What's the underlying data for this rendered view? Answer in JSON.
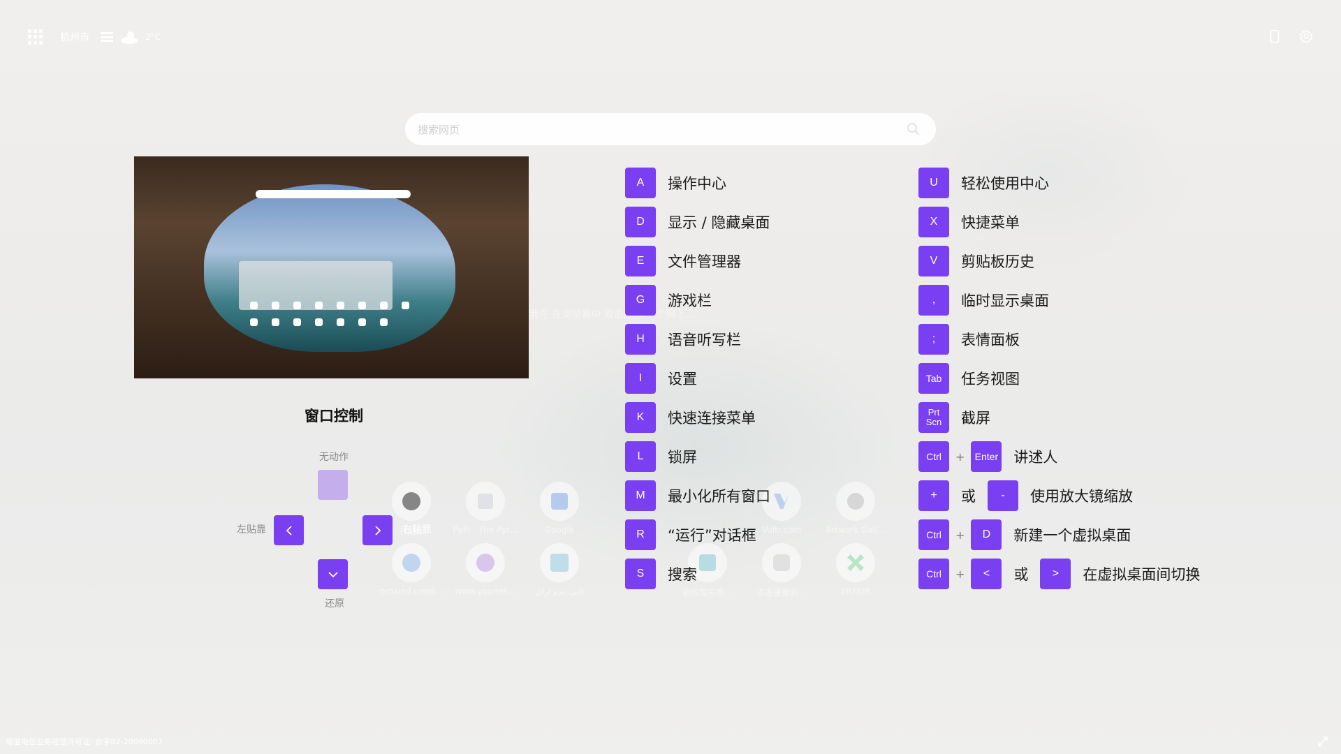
{
  "topbar": {
    "city": "杭州市",
    "temperature": "2°C"
  },
  "search": {
    "placeholder": "搜索网页"
  },
  "ghost_shortcuts": [
    {
      "label": "右贴靠",
      "icon": "github-icon"
    },
    {
      "label": "PyPI · The Pyt...",
      "icon": "pypi-icon"
    },
    {
      "label": "Google",
      "icon": "google-translate-icon"
    },
    {
      "label": "Vultr.com",
      "icon": "vultr-icon"
    },
    {
      "label": "Artwork Gall...",
      "icon": "paw-icon"
    },
    {
      "label": "proxied.unpd...",
      "icon": "u-icon"
    },
    {
      "label": "www.younes...",
      "icon": "v-icon"
    },
    {
      "label": "لایی بیرو ارای",
      "icon": "s-icon"
    },
    {
      "label": "必应每日高...",
      "icon": "bing-icon"
    },
    {
      "label": "点击量最的...",
      "icon": "disk-icon"
    },
    {
      "label": "ERROR",
      "icon": "x-icon"
    }
  ],
  "ghost_text": "我在 在浏览器中 双击图标 一个网上...",
  "window_control": {
    "title": "窗口控制",
    "no_action": "无动作",
    "snap_left": "左贴靠",
    "snap_right": "右贴靠",
    "restore": "还原",
    "up_glyph": "^",
    "left_glyph": "<",
    "right_glyph": ">",
    "down_glyph": "v"
  },
  "shortcuts_left": [
    {
      "key": "A",
      "desc": "操作中心"
    },
    {
      "key": "D",
      "desc": "显示 / 隐藏桌面"
    },
    {
      "key": "E",
      "desc": "文件管理器"
    },
    {
      "key": "G",
      "desc": "游戏栏"
    },
    {
      "key": "H",
      "desc": "语音听写栏"
    },
    {
      "key": "I",
      "desc": "设置"
    },
    {
      "key": "K",
      "desc": "快速连接菜单"
    },
    {
      "key": "L",
      "desc": "锁屏"
    },
    {
      "key": "M",
      "desc": "最小化所有窗口"
    },
    {
      "key": "R",
      "desc": "“运行”对话框"
    },
    {
      "key": "S",
      "desc": "搜索"
    }
  ],
  "shortcuts_right": [
    {
      "key": "U",
      "desc": "轻松使用中心"
    },
    {
      "key": "X",
      "desc": "快捷菜单"
    },
    {
      "key": "V",
      "desc": "剪贴板历史"
    },
    {
      "key": ",",
      "desc": "临时显示桌面"
    },
    {
      "key": ";",
      "desc": "表情面板"
    },
    {
      "key": "Tab",
      "desc": "任务视图"
    },
    {
      "key": "Prt Scn",
      "desc": "截屏"
    }
  ],
  "combos": {
    "narrator": {
      "k1": "Ctrl",
      "plus": "+",
      "k2": "Enter",
      "desc": "讲述人"
    },
    "magnifier": {
      "k1": "+",
      "or": "或",
      "k2": "-",
      "desc": "使用放大镜缩放"
    },
    "new_desktop": {
      "k1": "Ctrl",
      "plus": "+",
      "k2": "D",
      "desc": "新建一个虚拟桌面"
    },
    "switch_desktop": {
      "k1": "Ctrl",
      "plus": "+",
      "k2": "<",
      "or": "或",
      "k3": ">",
      "desc": "在虚拟桌面间切换"
    }
  },
  "footer": {
    "icp": "增值电信业务经营许可证: 合字B2-20090007"
  },
  "colors": {
    "accent": "#7b3ff2"
  }
}
